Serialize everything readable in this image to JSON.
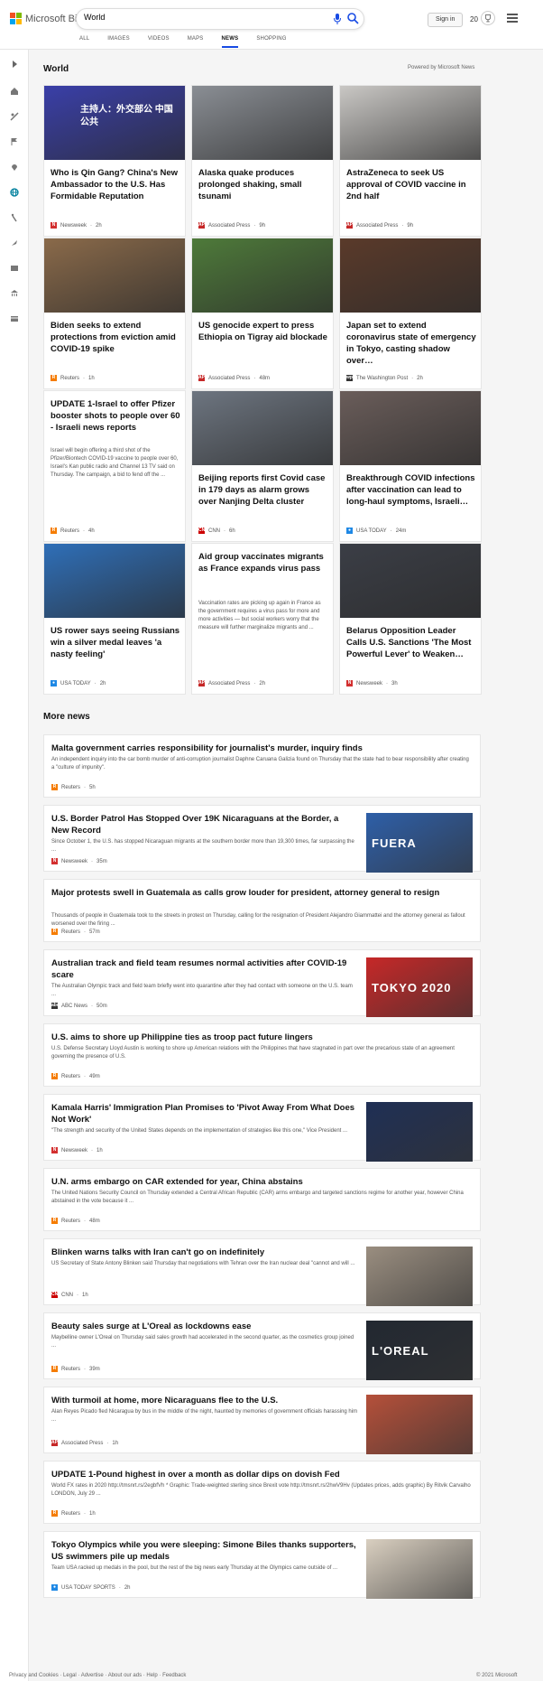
{
  "header": {
    "logo_text": "Microsoft Bing",
    "search_value": "World",
    "signin_label": "Sign in",
    "rewards_count": "20"
  },
  "nav": [
    "ALL",
    "IMAGES",
    "VIDEOS",
    "MAPS",
    "NEWS",
    "SHOPPING"
  ],
  "nav_active": "NEWS",
  "section": {
    "title": "World",
    "powered": "Powered by Microsoft News"
  },
  "cards": [
    {
      "title": "Who is Qin Gang? China's New Ambassador to the U.S. Has Formidable Reputation",
      "desc": "",
      "source": "Newsweek",
      "time": "2h",
      "logo": "N",
      "logo_color": "#d32f2f",
      "img_color": "#3a3fa8",
      "img_text": "主持人：外交部公 中国公共"
    },
    {
      "title": "Alaska quake produces prolonged shaking, small tsunami",
      "desc": "",
      "source": "Associated Press",
      "time": "9h",
      "logo": "AP",
      "logo_color": "#c62828",
      "img_color": "#8a8e94",
      "img_text": ""
    },
    {
      "title": "AstraZeneca to seek US approval of COVID vaccine in 2nd half",
      "desc": "",
      "source": "Associated Press",
      "time": "9h",
      "logo": "AP",
      "logo_color": "#c62828",
      "img_color": "#c9c7c4",
      "img_text": ""
    },
    {
      "title": "Biden seeks to extend protections from eviction amid COVID-19 spike",
      "desc": "",
      "source": "Reuters",
      "time": "1h",
      "logo": "R",
      "logo_color": "#f57c00",
      "img_color": "#8a6a4a",
      "img_text": ""
    },
    {
      "title": "US genocide expert to press Ethiopia on Tigray aid blockade",
      "desc": "",
      "source": "Associated Press",
      "time": "48m",
      "logo": "AP",
      "logo_color": "#c62828",
      "img_color": "#4e7a3a",
      "img_text": ""
    },
    {
      "title": "Japan set to extend coronavirus state of emergency in Tokyo, casting shadow over…",
      "desc": "",
      "source": "The Washington Post",
      "time": "2h",
      "logo": "wp",
      "logo_color": "#333333",
      "img_color": "#5a3a2a",
      "img_text": ""
    },
    {
      "title": "UPDATE 1-Israel to offer Pfizer booster shots to people over 60 - Israeli news reports",
      "desc": "Israel will begin offering a third shot of the Pfizer/Biontech COVID-19 vaccine to people over 60, Israel's Kan public radio and Channel 13 TV said on Thursday. The campaign, a bid to fend off the ...",
      "source": "Reuters",
      "time": "4h",
      "logo": "R",
      "logo_color": "#f57c00",
      "img_color": "",
      "img_text": ""
    },
    {
      "title": "Beijing reports first Covid case in 179 days as alarm grows over Nanjing Delta cluster",
      "desc": "",
      "source": "CNN",
      "time": "6h",
      "logo": "CNN",
      "logo_color": "#cc0000",
      "img_color": "#6d7580",
      "img_text": ""
    },
    {
      "title": "Breakthrough COVID infections after vaccination can lead to long-haul symptoms, Israeli…",
      "desc": "",
      "source": "USA TODAY",
      "time": "24m",
      "logo": "●",
      "logo_color": "#1e88e5",
      "img_color": "#6a5d5a",
      "img_text": ""
    },
    {
      "title": "US rower says seeing Russians win a silver medal leaves 'a nasty feeling'",
      "desc": "",
      "source": "USA TODAY",
      "time": "2h",
      "logo": "●",
      "logo_color": "#1e88e5",
      "img_color": "#2f6fb8",
      "img_text": ""
    },
    {
      "title": "Aid group vaccinates migrants as France expands virus pass",
      "desc": "Vaccination rates are picking up again in France as the government requires a virus pass for more and more activities — but social workers worry that the measure will further marginalize migrants and ...",
      "source": "Associated Press",
      "time": "2h",
      "logo": "AP",
      "logo_color": "#c62828",
      "img_color": "",
      "img_text": ""
    },
    {
      "title": "Belarus Opposition Leader Calls U.S. Sanctions 'The Most Powerful Lever' to Weaken…",
      "desc": "",
      "source": "Newsweek",
      "time": "3h",
      "logo": "N",
      "logo_color": "#d32f2f",
      "img_color": "#3b3e46",
      "img_text": ""
    }
  ],
  "more": {
    "title": "More news",
    "items": [
      {
        "title": "Malta government carries responsibility for journalist's murder, inquiry finds",
        "desc": "An independent inquiry into the car bomb murder of anti-corruption journalist Daphne Caruana Galizia found on Thursday that the state had to bear responsibility after creating a \"culture of impunity\".",
        "source": "Reuters",
        "time": "5h",
        "logo": "R",
        "logo_color": "#f57c00",
        "thumb": "",
        "thumb_text": ""
      },
      {
        "title": "U.S. Border Patrol Has Stopped Over 19K Nicaraguans at the Border, a New Record",
        "desc": "Since October 1, the U.S. has stopped Nicaraguan migrants at the southern border more than 19,300 times, far surpassing the ...",
        "source": "Newsweek",
        "time": "35m",
        "logo": "N",
        "logo_color": "#d32f2f",
        "thumb": "#2e5fa8",
        "thumb_text": "FUERA"
      },
      {
        "title": "Major protests swell in Guatemala as calls grow louder for president, attorney general to resign",
        "desc": "Thousands of people in Guatemala took to the streets in protest on Thursday, calling for the resignation of President Alejandro Giammattei and the attorney general as fallout worsened over the firing ...",
        "source": "Reuters",
        "time": "57m",
        "logo": "R",
        "logo_color": "#f57c00",
        "thumb": "",
        "thumb_text": ""
      },
      {
        "title": "Australian track and field team resumes normal activities after COVID-19 scare",
        "desc": "The Australian Olympic track and field team briefly went into quarantine after they had contact with someone on the U.S. team ...",
        "source": "ABC News",
        "time": "50m",
        "logo": "abc",
        "logo_color": "#333333",
        "thumb": "#c62828",
        "thumb_text": "TOKYO 2020"
      },
      {
        "title": "U.S. aims to shore up Philippine ties as troop pact future lingers",
        "desc": "U.S. Defense Secretary Lloyd Austin is working to shore up American relations with the Philippines that have stagnated in part over the precarious state of an agreement governing the presence of U.S.",
        "source": "Reuters",
        "time": "49m",
        "logo": "R",
        "logo_color": "#f57c00",
        "thumb": "",
        "thumb_text": ""
      },
      {
        "title": "Kamala Harris' Immigration Plan Promises to 'Pivot Away From What Does Not Work'",
        "desc": "\"The strength and security of the United States depends on the implementation of strategies like this one,\" Vice President ...",
        "source": "Newsweek",
        "time": "1h",
        "logo": "N",
        "logo_color": "#d32f2f",
        "thumb": "#1f2f55",
        "thumb_text": ""
      },
      {
        "title": "U.N. arms embargo on CAR extended for year, China abstains",
        "desc": "The United Nations Security Council on Thursday extended a Central African Republic (CAR) arms embargo and targeted sanctions regime for another year, however China abstained in the vote because it ...",
        "source": "Reuters",
        "time": "48m",
        "logo": "R",
        "logo_color": "#f57c00",
        "thumb": "",
        "thumb_text": ""
      },
      {
        "title": "Blinken warns talks with Iran can't go on indefinitely",
        "desc": "US Secretary of State Antony Blinken said Thursday that negotiations with Tehran over the Iran nuclear deal \"cannot and will ...",
        "source": "CNN",
        "time": "1h",
        "logo": "CNN",
        "logo_color": "#cc0000",
        "thumb": "#9a8e80",
        "thumb_text": ""
      },
      {
        "title": "Beauty sales surge at L'Oreal as lockdowns ease",
        "desc": "Maybelline owner L'Oreal on Thursday said sales growth had accelerated in the second quarter, as the cosmetics group joined ...",
        "source": "Reuters",
        "time": "39m",
        "logo": "R",
        "logo_color": "#f57c00",
        "thumb": "#222831",
        "thumb_text": "L'OREAL"
      },
      {
        "title": "With turmoil at home, more Nicaraguans flee to the U.S.",
        "desc": "Alan Reyes Picado fled Nicaragua by bus in the middle of the night, haunted by memories of government officials harassing him ...",
        "source": "Associated Press",
        "time": "1h",
        "logo": "AP",
        "logo_color": "#c62828",
        "thumb": "#b5503a",
        "thumb_text": ""
      },
      {
        "title": "UPDATE 1-Pound highest in over a month as dollar dips on dovish Fed",
        "desc": "World FX rates in 2020 http://tmsnrt.rs/2egbfVh * Graphic: Trade-weighted sterling since Brexit vote http://tmsnrt.rs/2hwV9Hv (Updates prices, adds graphic) By Ritvik Carvalho LONDON, July 29 ...",
        "source": "Reuters",
        "time": "1h",
        "logo": "R",
        "logo_color": "#f57c00",
        "thumb": "",
        "thumb_text": ""
      },
      {
        "title": "Tokyo Olympics while you were sleeping: Simone Biles thanks supporters, US swimmers pile up medals",
        "desc": "Team USA racked up medals in the pool, but the rest of the big news early Thursday at the Olympics came outside of ...",
        "source": "USA TODAY SPORTS",
        "time": "2h",
        "logo": "●",
        "logo_color": "#1e88e5",
        "thumb": "#d9cfc0",
        "thumb_text": ""
      }
    ]
  },
  "footer": {
    "text": "Privacy and Cookies · Legal · Advertise · About our ads · Help · Feedback",
    "copyright": "© 2021 Microsoft"
  },
  "colors": {
    "accent": "#174ae4",
    "brand_blue": "#00809d"
  }
}
